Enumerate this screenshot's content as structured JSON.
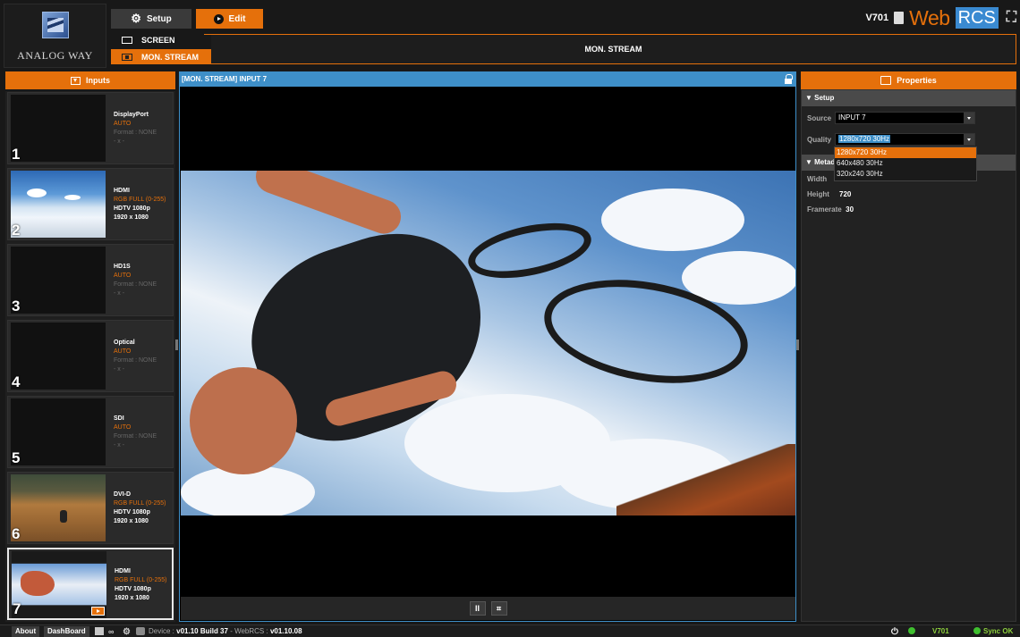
{
  "logo": {
    "text": "ANALOG WAY"
  },
  "topbar": {
    "setup_label": "Setup",
    "edit_label": "Edit",
    "device": "V701",
    "brand_web": "Web",
    "brand_rcs": "RCS"
  },
  "screens": [
    {
      "label": "SCREEN",
      "selected": false
    },
    {
      "label": "MON. STREAM",
      "selected": true
    }
  ],
  "banner": {
    "title": "MON. STREAM"
  },
  "inputs": {
    "header": "Inputs",
    "items": [
      {
        "num": "1",
        "name": "DisplayPort",
        "format": "AUTO",
        "line3": "Format : NONE",
        "line4": "- x -",
        "thumb": "none"
      },
      {
        "num": "2",
        "name": "HDMI",
        "format": "RGB FULL (0-255)",
        "line3": "HDTV 1080p",
        "line4": "1920 x 1080",
        "thumb": "snow"
      },
      {
        "num": "3",
        "name": "HD1S",
        "format": "AUTO",
        "line3": "Format : NONE",
        "line4": "- x -",
        "thumb": "none"
      },
      {
        "num": "4",
        "name": "Optical",
        "format": "AUTO",
        "line3": "Format : NONE",
        "line4": "- x -",
        "thumb": "none"
      },
      {
        "num": "5",
        "name": "SDI",
        "format": "AUTO",
        "line3": "Format : NONE",
        "line4": "- x -",
        "thumb": "none"
      },
      {
        "num": "6",
        "name": "DVI-D",
        "format": "RGB FULL (0-255)",
        "line3": "HDTV 1080p",
        "line4": "1920 x 1080",
        "thumb": "dirt"
      },
      {
        "num": "7",
        "name": "HDMI",
        "format": "RGB FULL (0-255)",
        "line3": "HDTV 1080p",
        "line4": "1920 x 1080",
        "thumb": "bmx",
        "selected": true
      }
    ]
  },
  "monitor": {
    "title": "[MON. STREAM] INPUT 7"
  },
  "properties": {
    "header": "Properties",
    "setup_section": "Setup",
    "source_label": "Source",
    "source_value": "INPUT 7",
    "quality_label": "Quality",
    "quality_value": "1280x720 30Hz",
    "quality_options": [
      "1280x720 30Hz",
      "640x480 30Hz",
      "320x240 30Hz"
    ],
    "metadata_section": "Metad",
    "width_label": "Width",
    "height_label": "Height",
    "height_value": "720",
    "framerate_label": "Framerate",
    "framerate_value": "30"
  },
  "footer": {
    "about": "About",
    "dashboard": "DashBoard",
    "device_label": "Device :",
    "device_version": "v01.10 Build 37",
    "webrcs_label": "- WebRCS :",
    "webrcs_version": "v01.10.08",
    "device": "V701",
    "sync": "Sync OK"
  },
  "colors": {
    "accent": "#e5700b",
    "blue": "#3e8fc8",
    "ok": "#3fbf2f"
  }
}
